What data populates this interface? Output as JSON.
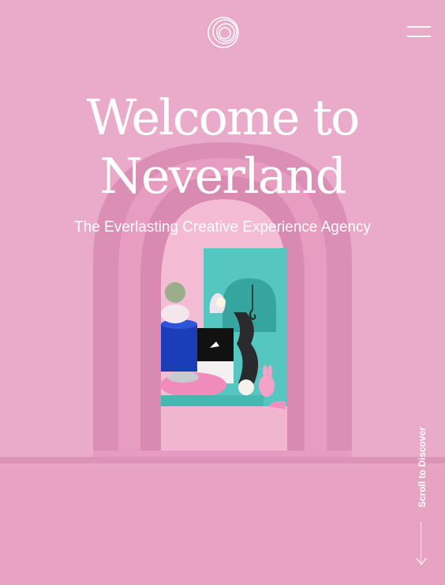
{
  "header": {
    "logo_icon": "spiral-logo-icon",
    "menu_icon": "hamburger-menu-icon"
  },
  "hero": {
    "title_line1": "Welcome to",
    "title_line2": "Neverland",
    "subtitle": "The Everlasting Creative Experience Agency"
  },
  "scroll_hint": {
    "label": "Scroll to Discover",
    "icon": "arrow-down-icon"
  },
  "colors": {
    "background": "#e8a9c9",
    "arch": "#e39abd",
    "teal": "#4fc5bf",
    "text": "#ffffff"
  }
}
